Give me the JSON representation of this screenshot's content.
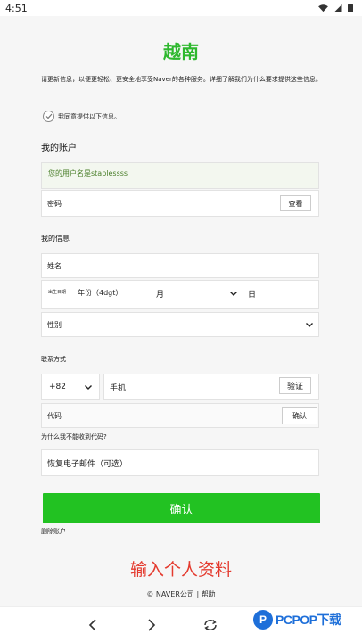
{
  "status_bar": {
    "time": "4:51"
  },
  "title": "越南",
  "intro_text": "请更新信息，以便更轻松、更安全地享受Naver的各种服务。详细了解我们为什么要求提供这些信息。",
  "consent_label": "我同意提供以下信息。",
  "account_section": {
    "title": "我的账户",
    "username_text": "您的用户名是staplessss",
    "password_label": "密码",
    "view_button": "查看"
  },
  "info_section": {
    "title": "我的信息",
    "name_label": "姓名",
    "dob_label": "出生日期",
    "year_placeholder": "年份（4dgt）",
    "month_label": "月",
    "day_label": "日",
    "gender_label": "性别"
  },
  "contact_section": {
    "title": "联系方式",
    "country_code": "+82",
    "phone_label": "手机",
    "verify_button": "验证",
    "code_label": "代码",
    "confirm_code_button": "确认",
    "no_code_link": "为什么我不能收到代码?",
    "recovery_email_label": "恢复电子邮件（可选）"
  },
  "confirm_button": "确认",
  "delete_account_link": "删除账户",
  "banner_text": "输入个人资料",
  "footer": {
    "copyright": "© NAVER公司",
    "separator": "|",
    "help": "帮助"
  },
  "watermark": {
    "logo_letter": "P",
    "text": "PCPOP下载"
  },
  "colors": {
    "accent_green": "#22c222",
    "title_green": "#2eb82e",
    "banner_red": "#e43a2e"
  },
  "icons": [
    "wifi-icon",
    "signal-icon",
    "battery-icon",
    "checkmark-icon",
    "chevron-down-icon",
    "back-arrow-icon",
    "forward-arrow-icon",
    "refresh-icon"
  ]
}
